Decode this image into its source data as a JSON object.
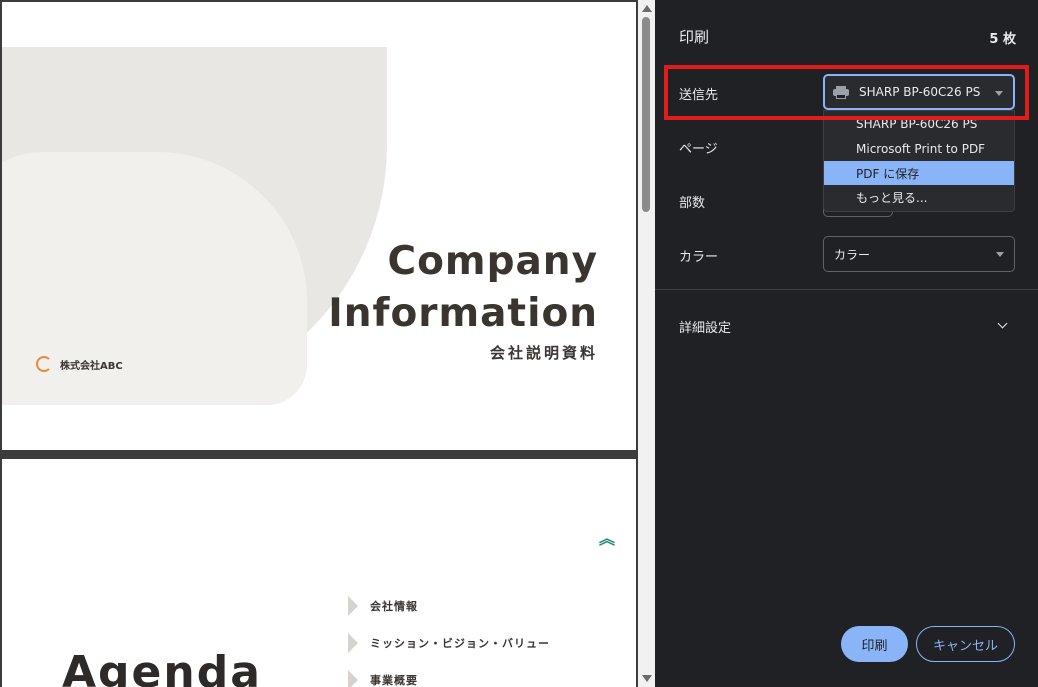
{
  "preview": {
    "cover": {
      "title_line1": "Company",
      "title_line2": "Information",
      "subtitle": "会社説明資料",
      "company": "株式会社ABC"
    },
    "agenda": {
      "title": "Agenda",
      "items": [
        "会社情報",
        "ミッション・ビジョン・バリュー",
        "事業概要"
      ]
    }
  },
  "panel": {
    "title": "印刷",
    "sheet_count": "5 枚",
    "destination": {
      "label": "送信先",
      "value": "SHARP BP-60C26 PS",
      "options": [
        "SHARP BP-60C26 PS",
        "Microsoft Print to PDF",
        "PDF に保存",
        "もっと見る..."
      ],
      "highlighted_option": "PDF に保存"
    },
    "pages_label": "ページ",
    "copies_label": "部数",
    "color": {
      "label": "カラー",
      "value": "カラー"
    },
    "advanced_label": "詳細設定",
    "print_button": "印刷",
    "cancel_button": "キャンセル"
  },
  "colors": {
    "accent": "#8ab4f8",
    "highlight_box": "#e21b1b",
    "panel_bg": "#202124"
  }
}
